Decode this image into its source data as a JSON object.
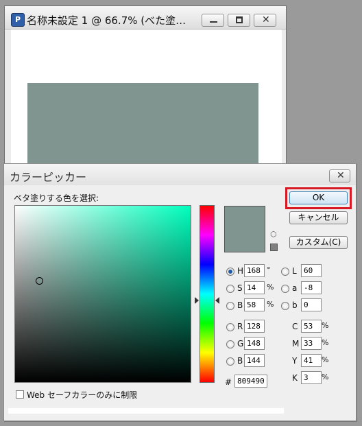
{
  "document": {
    "title": "名称未設定 1 @ 66.7% (べた塗…",
    "icon": "photoshop-document-icon",
    "fill_color": "#809490"
  },
  "picker": {
    "title": "カラーピッカー",
    "instruction": "ベタ塗りする色を選択:",
    "ok_label": "OK",
    "cancel_label": "キャンセル",
    "custom_label": "カスタム(C)",
    "web_only_label": "Web セーフカラーのみに制限",
    "hsb": {
      "h": {
        "label": "H",
        "value": "168",
        "unit": "°"
      },
      "s": {
        "label": "S",
        "value": "14",
        "unit": "%"
      },
      "b": {
        "label": "B",
        "value": "58",
        "unit": "%"
      }
    },
    "rgb": {
      "r": {
        "label": "R",
        "value": "128"
      },
      "g": {
        "label": "G",
        "value": "148"
      },
      "b": {
        "label": "B",
        "value": "144"
      }
    },
    "lab": {
      "l": {
        "label": "L",
        "value": "60"
      },
      "a": {
        "label": "a",
        "value": "-8"
      },
      "b": {
        "label": "b",
        "value": "0"
      }
    },
    "cmyk": {
      "c": {
        "label": "C",
        "value": "53",
        "unit": "%"
      },
      "m": {
        "label": "M",
        "value": "33",
        "unit": "%"
      },
      "y": {
        "label": "Y",
        "value": "41",
        "unit": "%"
      },
      "k": {
        "label": "K",
        "value": "3",
        "unit": "%"
      }
    },
    "hex": {
      "label": "#",
      "value": "809490"
    },
    "selected_mode": "H",
    "current_color": "#809490",
    "field_hue_color": "#00ffbd",
    "highlight_color": "#d81822"
  }
}
